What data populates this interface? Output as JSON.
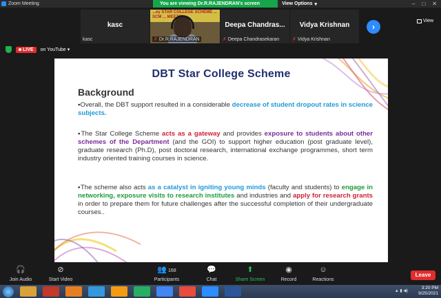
{
  "window": {
    "title": "Zoom Meeting",
    "controls": [
      "–",
      "□",
      "✕"
    ]
  },
  "viewing_banner": {
    "text": "You are viewing Dr.R.RAJENDRAN's screen",
    "view_options": "View Options"
  },
  "gallery": {
    "tiles": [
      {
        "name": "kasc",
        "sublabel": "kasc"
      },
      {
        "name": "",
        "sublabel": "Dr.R.RAJENDRAN",
        "video_banner": "...ey STAR COLLEGE SCHEME ... SCM ... MEETIN"
      },
      {
        "name": "Deepa  Chandras...",
        "sublabel": "Deepa Chandrasekaran"
      },
      {
        "name": "Vidya Krishnan",
        "sublabel": "Vidya Krishnan"
      }
    ],
    "next_icon": "chevron-right-icon",
    "view_label": "View"
  },
  "status": {
    "live_label": "LIVE",
    "stream_label": "on YouTube",
    "stream_caret": "▾"
  },
  "slide": {
    "title": "DBT Star College Scheme",
    "heading": "Background",
    "paragraphs": {
      "p1": {
        "a": "▪Overall, the DBT support resulted in a considerable ",
        "b": "decrease of student dropout rates in science subjects."
      },
      "p2": {
        "a": "▪The  Star College Scheme ",
        "b": "acts as a gateway",
        "c": " and provides ",
        "d": "exposure to students about other schemes of the Department",
        "e": " (and the GOI) to support higher education (post graduate level), graduate research (Ph.D), post doctoral research, international exchange programmes, short term industry oriented training courses in science."
      },
      "p3": {
        "a": "▪The scheme also acts ",
        "b": "as a catalyst in igniting young minds",
        "c": " (faculty and students) to ",
        "d": "engage in networking, exposure visits to research institutes",
        "e": " and industries and ",
        "f": "apply for research grants",
        "g": " in order to prepare them for future challenges after the successful completion of their undergraduate courses.."
      }
    }
  },
  "toolbar": {
    "join_audio": "Join Audio",
    "start_video": "Start Video",
    "participants": "Participants",
    "participants_count": "168",
    "chat": "Chat",
    "share_screen": "Share Screen",
    "record": "Record",
    "reactions": "Reactions",
    "leave": "Leave"
  },
  "taskbar": {
    "time": "3:20 PM",
    "date": "9/25/2021"
  },
  "colors": {
    "zoom_blue": "#2d8cff",
    "banner_green": "#17a54b",
    "leave_red": "#e02d2d",
    "slide_title": "#1f2e6e",
    "highlight_blue": "#1f9ad6",
    "highlight_red": "#d02035",
    "highlight_purple": "#7a2b9a",
    "highlight_green": "#1c9c3a"
  }
}
